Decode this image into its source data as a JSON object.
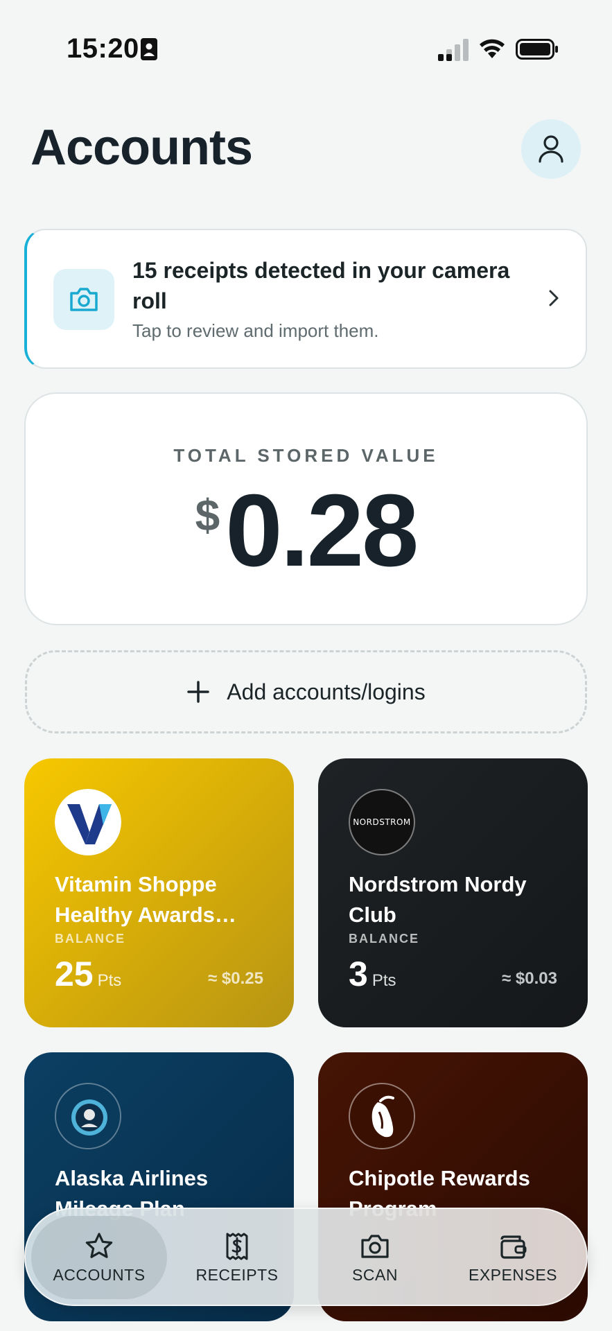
{
  "status_bar": {
    "time": "15:20"
  },
  "header": {
    "title": "Accounts"
  },
  "banner": {
    "title": "15 receipts detected in your camera roll",
    "subtitle": "Tap to review and import them."
  },
  "total": {
    "label": "TOTAL STORED VALUE",
    "currency": "$",
    "value": "0.28"
  },
  "add_accounts": {
    "label": "Add accounts/logins"
  },
  "accounts": [
    {
      "name": "Vitamin Shoppe Healthy Awards…",
      "balance_label": "BALANCE",
      "balance": "25",
      "unit": "Pts",
      "approx": "≈ $0.25",
      "logo_text": ""
    },
    {
      "name": "Nordstrom Nordy Club",
      "balance_label": "BALANCE",
      "balance": "3",
      "unit": "Pts",
      "approx": "≈ $0.03",
      "logo_text": "NORDSTROM"
    },
    {
      "name": "Alaska Airlines Mileage Plan",
      "balance_label": "",
      "balance": "",
      "unit": "",
      "approx": "",
      "logo_text": ""
    },
    {
      "name": "Chipotle Rewards Program",
      "balance_label": "",
      "balance": "",
      "unit": "",
      "approx": "",
      "logo_text": ""
    }
  ],
  "nav": {
    "items": [
      {
        "label": "ACCOUNTS",
        "icon": "star-icon",
        "active": true
      },
      {
        "label": "RECEIPTS",
        "icon": "receipt-dollar-icon",
        "active": false
      },
      {
        "label": "SCAN",
        "icon": "camera-icon",
        "active": false
      },
      {
        "label": "EXPENSES",
        "icon": "wallet-icon",
        "active": false
      }
    ]
  },
  "colors": {
    "accent": "#19b0d8",
    "background": "#f4f6f6",
    "vitamin_card": "#f6c800",
    "nordstrom_card": "#1e2225",
    "alaska_card": "#0b3f63",
    "chipotle_card": "#451404"
  }
}
